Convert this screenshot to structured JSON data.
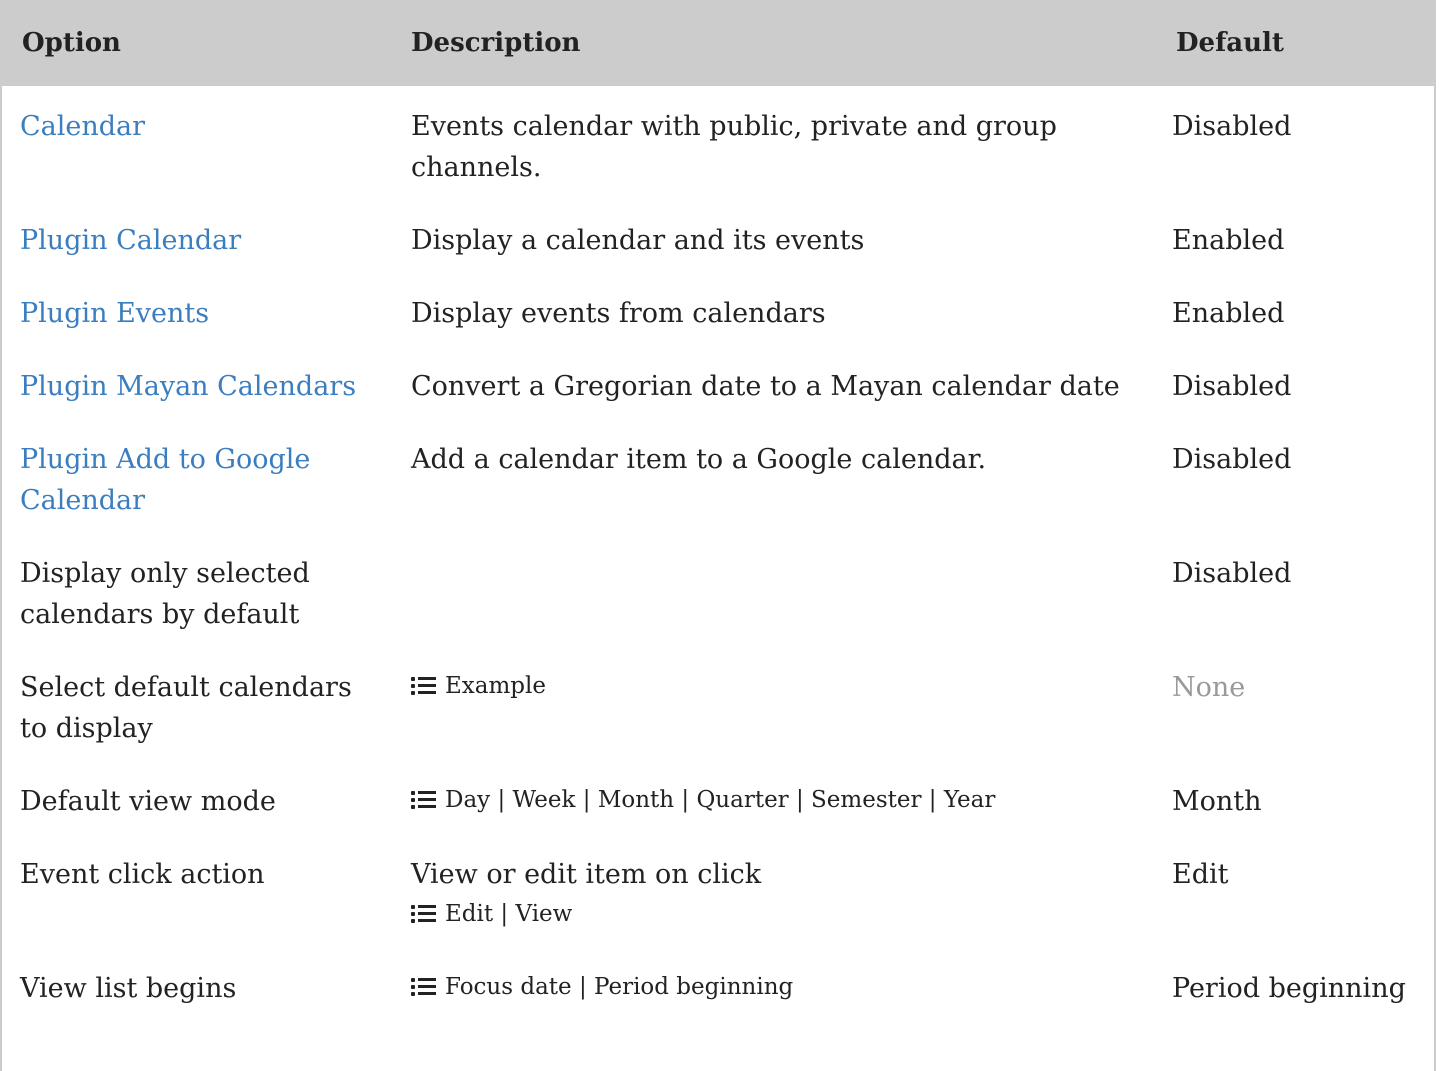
{
  "table": {
    "headers": {
      "option": "Option",
      "description": "Description",
      "default": "Default"
    },
    "rows": [
      {
        "option": "Calendar",
        "option_is_link": true,
        "description": "Events calendar with public, private and group channels.",
        "default": "Disabled"
      },
      {
        "option": "Plugin Calendar",
        "option_is_link": true,
        "description": "Display a calendar and its events",
        "default": "Enabled"
      },
      {
        "option": "Plugin Events",
        "option_is_link": true,
        "description": "Display events from calendars",
        "default": "Enabled"
      },
      {
        "option": "Plugin Mayan Calendars",
        "option_is_link": true,
        "description": "Convert a Gregorian date to a Mayan calendar date",
        "default": "Disabled"
      },
      {
        "option": "Plugin Add to Google Calendar",
        "option_is_link": true,
        "description": "Add a calendar item to a Google calendar.",
        "default": "Disabled"
      },
      {
        "option": "Display only selected calendars by default",
        "option_is_link": false,
        "description": "",
        "default": "Disabled"
      },
      {
        "option": "Select default calendars to display",
        "option_is_link": false,
        "description": "",
        "choices": "Example",
        "default": "None",
        "default_muted": true
      },
      {
        "option": "Default view mode",
        "option_is_link": false,
        "description": "",
        "choices": "Day | Week | Month | Quarter | Semester | Year",
        "default": "Month"
      },
      {
        "option": "Event click action",
        "option_is_link": false,
        "description": "View or edit item on click",
        "choices": "Edit | View",
        "default": "Edit"
      },
      {
        "option": "View list begins",
        "option_is_link": false,
        "description": "",
        "choices": "Focus date | Period beginning",
        "default": "Period beginning"
      }
    ]
  },
  "icons": {
    "choices": "list-icon"
  },
  "colors": {
    "header_bg": "#cccccc",
    "link": "#3a7ebf",
    "muted": "#999999",
    "text": "#222222"
  }
}
